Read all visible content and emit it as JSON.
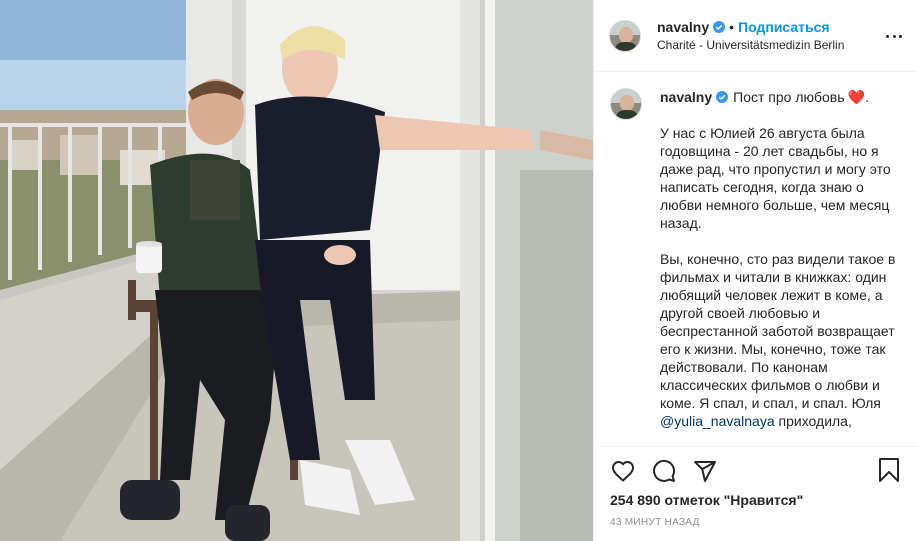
{
  "post": {
    "username": "navalny",
    "follow_label": "Подписаться",
    "separator": "•",
    "location": "Charité - Universitätsmedizin Berlin",
    "photo_alt": "Фото поста",
    "more_icon": "more-horizontal-icon",
    "verified_color": "#3897f0",
    "accent_color": "#0095f6"
  },
  "caption": {
    "username": "navalny",
    "title": "Пост про любовь",
    "heart": "❤️",
    "heart_suffix": ".",
    "paragraph1": "У нас с Юлией 26 августа была годовщина - 20 лет свадьбы, но я даже рад, что пропустил и могу это написать сегодня, когда знаю о любви немного больше, чем месяц назад.",
    "paragraph2_part1": "Вы, конечно, сто раз видели такое в фильмах и читали в книжках: один любящий человек лежит в коме, а другой своей любовью и беспрестанной заботой возвращает его к жизни. Мы, конечно, тоже так действовали. По канонам классических фильмов о любви и коме. Я спал, и спал, и спал. Юля",
    "mention": "@yulia_navalnaya",
    "paragraph2_part2": "приходила,"
  },
  "actions": {
    "like_icon": "heart-outline-icon",
    "comment_icon": "comment-icon",
    "share_icon": "share-icon",
    "save_icon": "bookmark-icon",
    "likes_count": "254 890",
    "likes_text": "отметок \"Нравится\"",
    "timestamp": "43 МИНУТ НАЗАД"
  }
}
